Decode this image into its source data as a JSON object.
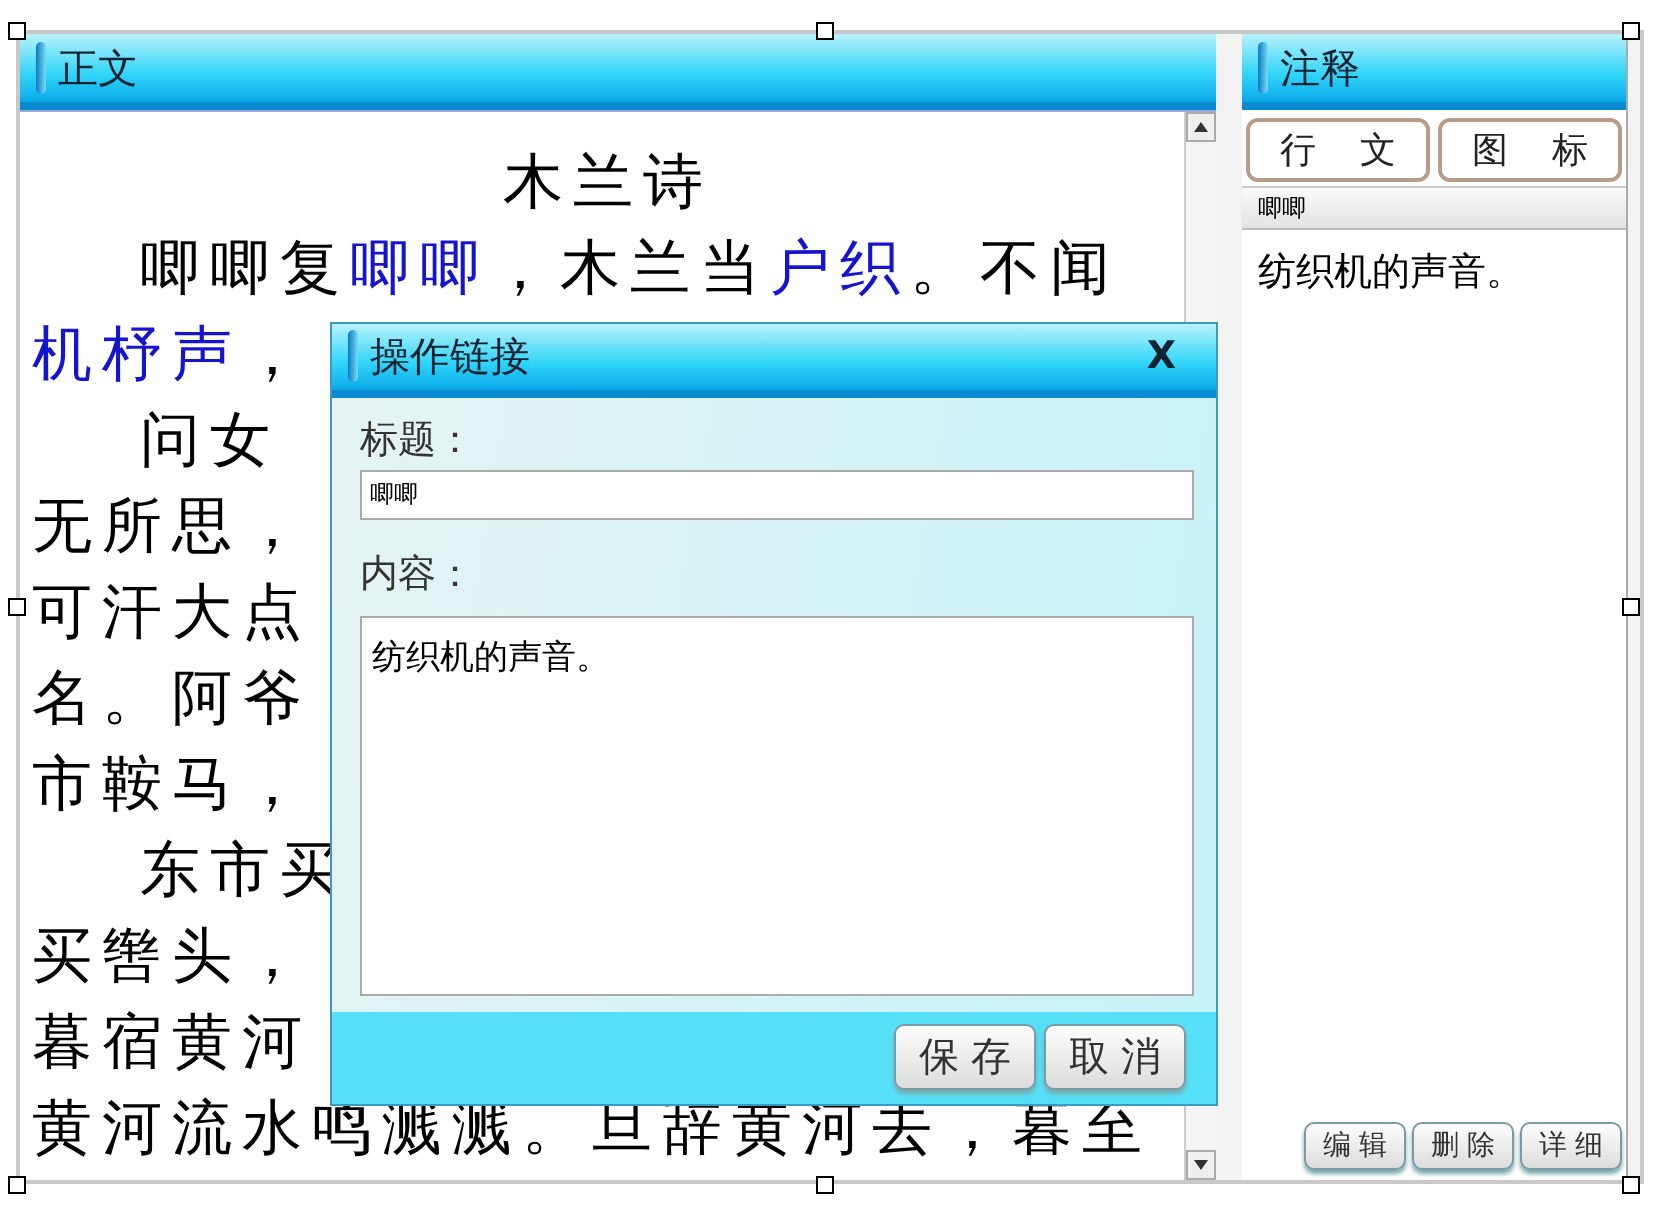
{
  "document": {
    "title": "正文",
    "heading": "木兰诗",
    "lines": [
      {
        "indent": true,
        "segments": [
          {
            "text": "唧唧复",
            "link": false
          },
          {
            "text": "唧唧",
            "link": true
          },
          {
            "text": "，木兰当",
            "link": false
          },
          {
            "text": "户织",
            "link": true
          },
          {
            "text": "。不闻",
            "link": false
          }
        ]
      },
      {
        "indent": false,
        "segments": [
          {
            "text": "机杼声",
            "link": true
          },
          {
            "text": "，",
            "link": false
          }
        ]
      },
      {
        "indent": true,
        "segments": [
          {
            "text": "问女",
            "link": false
          }
        ]
      },
      {
        "indent": false,
        "segments": [
          {
            "text": "无所思，",
            "link": false
          }
        ]
      },
      {
        "indent": false,
        "segments": [
          {
            "text": "可汗大点",
            "link": false
          }
        ]
      },
      {
        "indent": false,
        "segments": [
          {
            "text": "名。阿爷",
            "link": false
          }
        ]
      },
      {
        "indent": false,
        "segments": [
          {
            "text": "市鞍马，",
            "link": false
          }
        ]
      },
      {
        "indent": true,
        "segments": [
          {
            "text": "东市买",
            "link": false
          }
        ]
      },
      {
        "indent": false,
        "segments": [
          {
            "text": "买辔头，",
            "link": false
          }
        ]
      },
      {
        "indent": false,
        "segments": [
          {
            "text": "暮宿黄河",
            "link": false
          }
        ]
      },
      {
        "indent": false,
        "segments": [
          {
            "text": "黄河流水鸣溅溅。旦辞黄河去，暮至",
            "link": false
          }
        ]
      }
    ]
  },
  "notes": {
    "title": "注释",
    "tabs": [
      {
        "label": "行 文",
        "selected": false
      },
      {
        "label": "图 标",
        "selected": false
      }
    ],
    "term": "唧唧",
    "definition": "纺织机的声音。",
    "buttons": [
      "编 辑",
      "删 除",
      "详 细"
    ]
  },
  "dialog": {
    "title": "操作链接",
    "close": "X",
    "title_label": "标题：",
    "title_value": "唧唧",
    "content_label": "内容：",
    "content_value": "纺织机的声音。",
    "buttons": [
      "保 存",
      "取 消"
    ]
  }
}
